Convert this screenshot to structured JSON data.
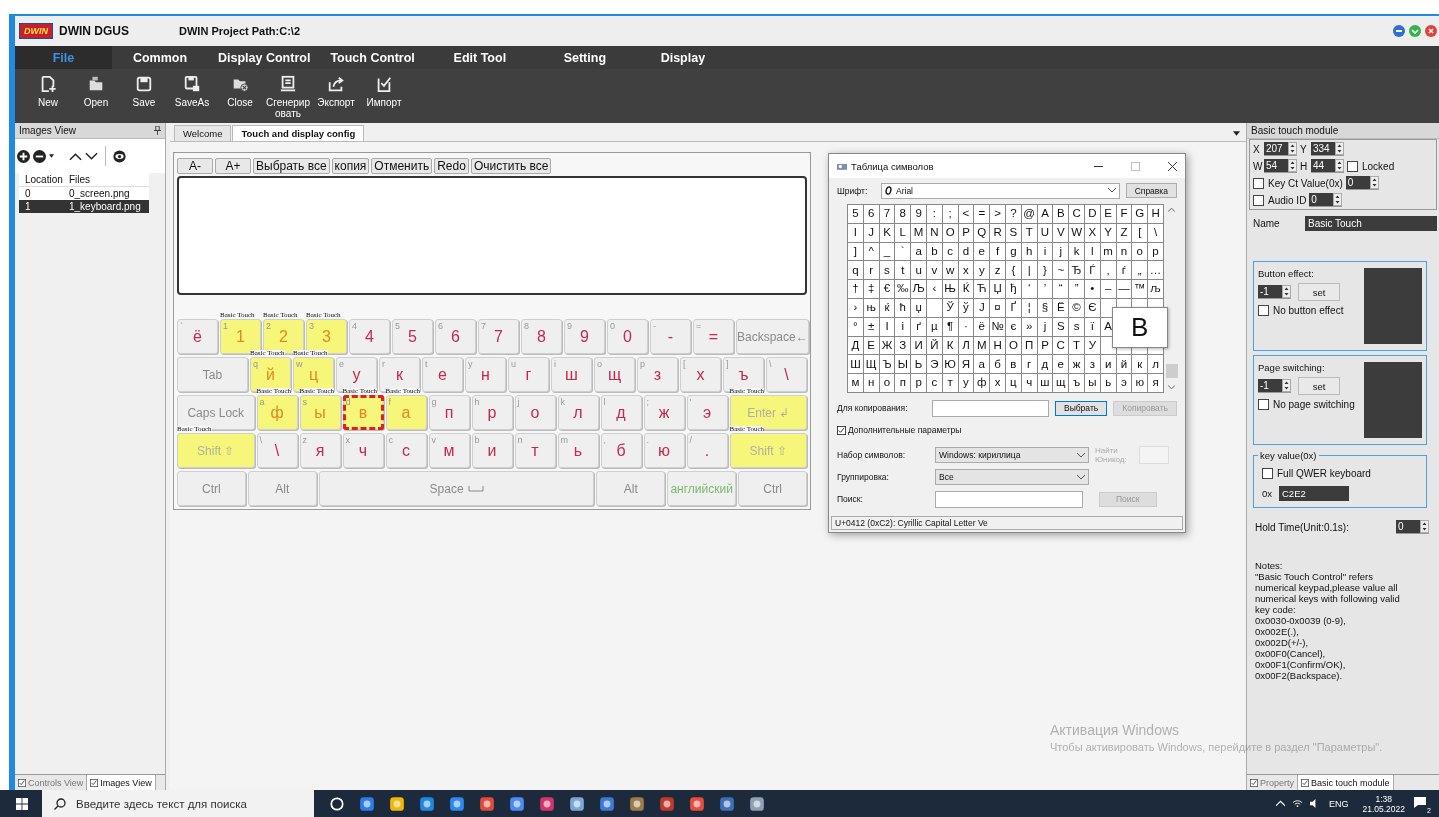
{
  "app": {
    "logo": "DWIN",
    "title": "DWIN DGUS",
    "project_path": "DWIN Project Path:C:\\2"
  },
  "menu": [
    {
      "label": "File",
      "selected": true
    },
    {
      "label": "Common",
      "selected": false
    },
    {
      "label": "Display Control",
      "selected": false
    },
    {
      "label": "Touch Control",
      "selected": false
    },
    {
      "label": "Edit Tool",
      "selected": false
    },
    {
      "label": "Setting",
      "selected": false
    },
    {
      "label": "Display",
      "selected": false
    }
  ],
  "toolbar": [
    {
      "label": "New",
      "kind": "new"
    },
    {
      "label": "Open",
      "kind": "open"
    },
    {
      "label": "Save",
      "kind": "save"
    },
    {
      "label": "SaveAs",
      "kind": "saveas"
    },
    {
      "label": "Close",
      "kind": "close"
    },
    {
      "label": "Сгенерир\nовать",
      "kind": "generate"
    },
    {
      "label": "Экспорт",
      "kind": "export"
    },
    {
      "label": "Импорт",
      "kind": "import"
    }
  ],
  "images_view": {
    "title": "Images View",
    "columns": [
      "Location",
      "Files"
    ],
    "rows": [
      {
        "location": "0",
        "file": "0_screen.png",
        "selected": false
      },
      {
        "location": "1",
        "file": "1_keyboard.png",
        "selected": true
      }
    ],
    "bottom_tabs": [
      {
        "label": "Controls View",
        "selected": false
      },
      {
        "label": "Images View",
        "selected": true
      }
    ]
  },
  "doc_tabs": [
    {
      "label": "Welcome",
      "selected": false
    },
    {
      "label": "Touch and display config",
      "selected": true
    }
  ],
  "editor": {
    "buttons": [
      "A-",
      "A+",
      "Выбрать все",
      "копия",
      "Отменить",
      "Redo",
      "Очистить все"
    ]
  },
  "keyboard": {
    "rows": [
      {
        "keys": [
          {
            "sub": "`",
            "label": "ё",
            "kind": "char",
            "highlighted": false,
            "selected": false
          },
          {
            "sub": "1",
            "label": "1",
            "kind": "char",
            "highlighted": true,
            "selected": false,
            "tag": "Basic Touch"
          },
          {
            "sub": "2",
            "label": "2",
            "kind": "char",
            "highlighted": true,
            "selected": false,
            "tag": "Basic Touch"
          },
          {
            "sub": "3",
            "label": "3",
            "kind": "char",
            "highlighted": true,
            "selected": false,
            "tag": "Basic Touch"
          },
          {
            "sub": "4",
            "label": "4",
            "kind": "char",
            "highlighted": false,
            "selected": false
          },
          {
            "sub": "5",
            "label": "5",
            "kind": "char",
            "highlighted": false,
            "selected": false
          },
          {
            "sub": "6",
            "label": "6",
            "kind": "char",
            "highlighted": false,
            "selected": false
          },
          {
            "sub": "7",
            "label": "7",
            "kind": "char",
            "highlighted": false,
            "selected": false
          },
          {
            "sub": "8",
            "label": "8",
            "kind": "char",
            "highlighted": false,
            "selected": false
          },
          {
            "sub": "9",
            "label": "9",
            "kind": "char",
            "highlighted": false,
            "selected": false
          },
          {
            "sub": "0",
            "label": "0",
            "kind": "char",
            "highlighted": false,
            "selected": false
          },
          {
            "sub": "-",
            "label": "-",
            "kind": "char",
            "highlighted": false,
            "selected": false
          },
          {
            "sub": "=",
            "label": "=",
            "kind": "char",
            "highlighted": false,
            "selected": false
          },
          {
            "label": "Backspace←",
            "kind": "func",
            "highlighted": false,
            "selected": false
          }
        ]
      },
      {
        "keys": [
          {
            "label": "Tab",
            "kind": "func",
            "highlighted": false,
            "selected": false
          },
          {
            "sub": "q",
            "label": "й",
            "kind": "char",
            "highlighted": true,
            "selected": false,
            "tag": "Basic Touch"
          },
          {
            "sub": "w",
            "label": "ц",
            "kind": "char",
            "highlighted": true,
            "selected": false,
            "tag": "Basic Touch"
          },
          {
            "sub": "e",
            "label": "у",
            "kind": "char",
            "highlighted": false,
            "selected": false
          },
          {
            "sub": "r",
            "label": "к",
            "kind": "char",
            "highlighted": false,
            "selected": false
          },
          {
            "sub": "t",
            "label": "е",
            "kind": "char",
            "highlighted": false,
            "selected": false
          },
          {
            "sub": "y",
            "label": "н",
            "kind": "char",
            "highlighted": false,
            "selected": false
          },
          {
            "sub": "u",
            "label": "г",
            "kind": "char",
            "highlighted": false,
            "selected": false
          },
          {
            "sub": "i",
            "label": "ш",
            "kind": "char",
            "highlighted": false,
            "selected": false
          },
          {
            "sub": "o",
            "label": "щ",
            "kind": "char",
            "highlighted": false,
            "selected": false
          },
          {
            "sub": "p",
            "label": "з",
            "kind": "char",
            "highlighted": false,
            "selected": false
          },
          {
            "sub": "[",
            "label": "х",
            "kind": "char",
            "highlighted": false,
            "selected": false
          },
          {
            "sub": "]",
            "label": "ъ",
            "kind": "char",
            "highlighted": false,
            "selected": false
          },
          {
            "sub": "\\",
            "label": "\\",
            "kind": "char",
            "highlighted": false,
            "selected": false
          }
        ]
      },
      {
        "keys": [
          {
            "label": "Caps Lock",
            "kind": "func",
            "highlighted": false,
            "selected": false
          },
          {
            "sub": "a",
            "label": "ф",
            "kind": "char",
            "highlighted": true,
            "selected": false,
            "tag": "Basic Touch"
          },
          {
            "sub": "s",
            "label": "ы",
            "kind": "char",
            "highlighted": true,
            "selected": false,
            "tag": "Basic Touch"
          },
          {
            "sub": "d",
            "label": "в",
            "kind": "char",
            "highlighted": true,
            "selected": true,
            "tag": "Basic Touch"
          },
          {
            "sub": "f",
            "label": "а",
            "kind": "char",
            "highlighted": true,
            "selected": false,
            "tag": "Basic Touch"
          },
          {
            "sub": "g",
            "label": "п",
            "kind": "char",
            "highlighted": false,
            "selected": false
          },
          {
            "sub": "h",
            "label": "р",
            "kind": "char",
            "highlighted": false,
            "selected": false
          },
          {
            "sub": "j",
            "label": "о",
            "kind": "char",
            "highlighted": false,
            "selected": false
          },
          {
            "sub": "k",
            "label": "л",
            "kind": "char",
            "highlighted": false,
            "selected": false
          },
          {
            "sub": "l",
            "label": "д",
            "kind": "char",
            "highlighted": false,
            "selected": false
          },
          {
            "sub": ";",
            "label": "ж",
            "kind": "char",
            "highlighted": false,
            "selected": false
          },
          {
            "sub": "'",
            "label": "э",
            "kind": "char",
            "highlighted": false,
            "selected": false
          },
          {
            "label": "Enter ↲",
            "kind": "func",
            "highlighted": true,
            "selected": false,
            "tag": "Basic Touch"
          }
        ]
      },
      {
        "keys": [
          {
            "label": "Shift ⇧",
            "kind": "func",
            "highlighted": true,
            "selected": false,
            "tag": "Basic Touch"
          },
          {
            "sub": "\\",
            "label": "\\",
            "kind": "char",
            "highlighted": false,
            "selected": false
          },
          {
            "sub": "z",
            "label": "я",
            "kind": "char",
            "highlighted": false,
            "selected": false
          },
          {
            "sub": "x",
            "label": "ч",
            "kind": "char",
            "highlighted": false,
            "selected": false
          },
          {
            "sub": "c",
            "label": "с",
            "kind": "char",
            "highlighted": false,
            "selected": false
          },
          {
            "sub": "v",
            "label": "м",
            "kind": "char",
            "highlighted": false,
            "selected": false
          },
          {
            "sub": "b",
            "label": "и",
            "kind": "char",
            "highlighted": false,
            "selected": false
          },
          {
            "sub": "n",
            "label": "т",
            "kind": "char",
            "highlighted": false,
            "selected": false
          },
          {
            "sub": "m",
            "label": "ь",
            "kind": "char",
            "highlighted": false,
            "selected": false
          },
          {
            "sub": ",",
            "label": "б",
            "kind": "char",
            "highlighted": false,
            "selected": false
          },
          {
            "sub": ".",
            "label": "ю",
            "kind": "char",
            "highlighted": false,
            "selected": false
          },
          {
            "sub": "/",
            "label": ".",
            "kind": "char",
            "highlighted": false,
            "selected": false
          },
          {
            "label": "Shift ⇧",
            "kind": "func",
            "highlighted": true,
            "selected": false,
            "tag": "Basic Touch"
          }
        ]
      },
      {
        "keys": [
          {
            "label": "Ctrl",
            "kind": "func",
            "highlighted": false,
            "selected": false
          },
          {
            "label": "Alt",
            "kind": "func",
            "highlighted": false,
            "selected": false
          },
          {
            "label": "Space",
            "kind": "space",
            "highlighted": false,
            "selected": false
          },
          {
            "label": "Alt",
            "kind": "func",
            "highlighted": false,
            "selected": false
          },
          {
            "label": "английский",
            "kind": "lang",
            "highlighted": false,
            "selected": false
          },
          {
            "label": "Ctrl",
            "kind": "func",
            "highlighted": false,
            "selected": false
          }
        ]
      }
    ]
  },
  "charmap": {
    "title": "Таблица символов",
    "font_label": "Шрифт:",
    "font": "Arial",
    "help": "Справка",
    "grid": [
      [
        "5",
        "6",
        "7",
        "8",
        "9",
        ":",
        ";",
        "<",
        "=",
        ">",
        "?",
        "@",
        "A",
        "B",
        "C",
        "D",
        "E",
        "F",
        "G",
        "H"
      ],
      [
        "I",
        "J",
        "K",
        "L",
        "M",
        "N",
        "O",
        "P",
        "Q",
        "R",
        "S",
        "T",
        "U",
        "V",
        "W",
        "X",
        "Y",
        "Z",
        "[",
        "\\"
      ],
      [
        "]",
        "^",
        "_",
        "`",
        "a",
        "b",
        "c",
        "d",
        "e",
        "f",
        "g",
        "h",
        "i",
        "j",
        "k",
        "l",
        "m",
        "n",
        "o",
        "p"
      ],
      [
        "q",
        "r",
        "s",
        "t",
        "u",
        "v",
        "w",
        "x",
        "y",
        "z",
        "{",
        "|",
        "}",
        "~",
        "Ђ",
        "Ѓ",
        "‚",
        "ѓ",
        "„",
        "…"
      ],
      [
        "†",
        "‡",
        "€",
        "‰",
        "Љ",
        "‹",
        "Њ",
        "Ќ",
        "Ћ",
        "Џ",
        "ђ",
        "‘",
        "’",
        "“",
        "”",
        "•",
        "–",
        "—",
        "™",
        "љ"
      ],
      [
        "›",
        "њ",
        "ќ",
        "ћ",
        "џ",
        {
          "kind": "blank"
        },
        "Ў",
        "ў",
        "Ј",
        "¤",
        "Ґ",
        "¦",
        "§",
        "Ё",
        "©",
        "Є"
      ],
      [
        "°",
        "±",
        "І",
        "і",
        "ґ",
        "µ",
        "¶",
        "·",
        "ё",
        "№",
        "є",
        "»",
        "ј",
        "Ѕ",
        "ѕ",
        "ї",
        "А"
      ],
      [
        "Д",
        "Е",
        "Ж",
        "З",
        "И",
        "Й",
        "К",
        "Л",
        "М",
        "Н",
        "О",
        "П",
        "Р",
        "С",
        "Т",
        "У"
      ],
      [
        "Ш",
        "Щ",
        "Ъ",
        "Ы",
        "Ь",
        "Э",
        "Ю",
        "Я",
        "а",
        "б",
        "в",
        "г",
        "д",
        "е",
        "ж",
        "з",
        "и",
        "й",
        "к",
        "л"
      ],
      [
        "м",
        "н",
        "о",
        "п",
        "р",
        "с",
        "т",
        "у",
        "ф",
        "х",
        "ц",
        "ч",
        "ш",
        "щ",
        "ъ",
        "ы",
        "ь",
        "э",
        "ю",
        "я"
      ]
    ],
    "magnified": "В",
    "copy_label": "Для копирования:",
    "select": "Выбрать",
    "copy": "Копировать",
    "advanced": {
      "label": "Дополнительные параметры",
      "checked": true
    },
    "charset_label": "Набор символов:",
    "charset": "Windows: кириллица",
    "unicode_label": "Найти\nЮникод:",
    "group_label": "Группировка:",
    "group": "Все",
    "search_label": "Поиск:",
    "search_button": "Поиск",
    "status": "U+0412 (0xC2): Cyrillic Capital Letter Ve"
  },
  "properties": {
    "title": "Basic touch module",
    "coords": [
      {
        "label": "X",
        "value": "207"
      },
      {
        "label": "Y",
        "value": "334"
      },
      {
        "label": "W",
        "value": "54"
      },
      {
        "label": "H",
        "value": "44"
      }
    ],
    "locked": {
      "label": "Locked",
      "checked": false
    },
    "key_ct": {
      "label": "Key Ct Value(0x)",
      "checked": false,
      "value": "0"
    },
    "audio": {
      "label": "Audio ID",
      "checked": false,
      "value": "0"
    },
    "name_label": "Name",
    "name": "Basic Touch",
    "effects": [
      {
        "label": "Button effect:",
        "value": "-1",
        "set": "set",
        "option": "No button effect",
        "checked": false
      },
      {
        "label": "Page switching:",
        "value": "-1",
        "set": "set",
        "option": "No page switching",
        "checked": false
      }
    ],
    "key_value": {
      "legend": "key value(0x)",
      "option": "Full QWER keyboard",
      "checked": false,
      "prefix": "0x",
      "value": "C2E2"
    },
    "hold_label": "Hold Time(Unit:0.1s):",
    "hold": "0",
    "notes": [
      "Notes:",
      "\"Basic Touch Control\" refers",
      "numerical keypad,please value all",
      "numerical keys with following valid",
      "key code:",
      "0x0030-0x0039 (0-9),",
      "0x002E(.),",
      "0x002D(+/-),",
      "0x00F0(Cancel),",
      "0x00F1(Confirm/OK),",
      "0x00F2(Backspace)."
    ],
    "bottom_tabs": [
      {
        "label": "Property",
        "selected": false
      },
      {
        "label": "Basic touch module",
        "selected": true
      }
    ]
  },
  "watermark": {
    "title": "Активация Windows",
    "text": "Чтобы активировать Windows, перейдите в раздел \"Параметры\"."
  },
  "taskbar": {
    "search_placeholder": "Введите здесь текст для поиска",
    "lang": "ENG",
    "time": "1:38",
    "date": "21.05.2022",
    "notifications": "2"
  }
}
